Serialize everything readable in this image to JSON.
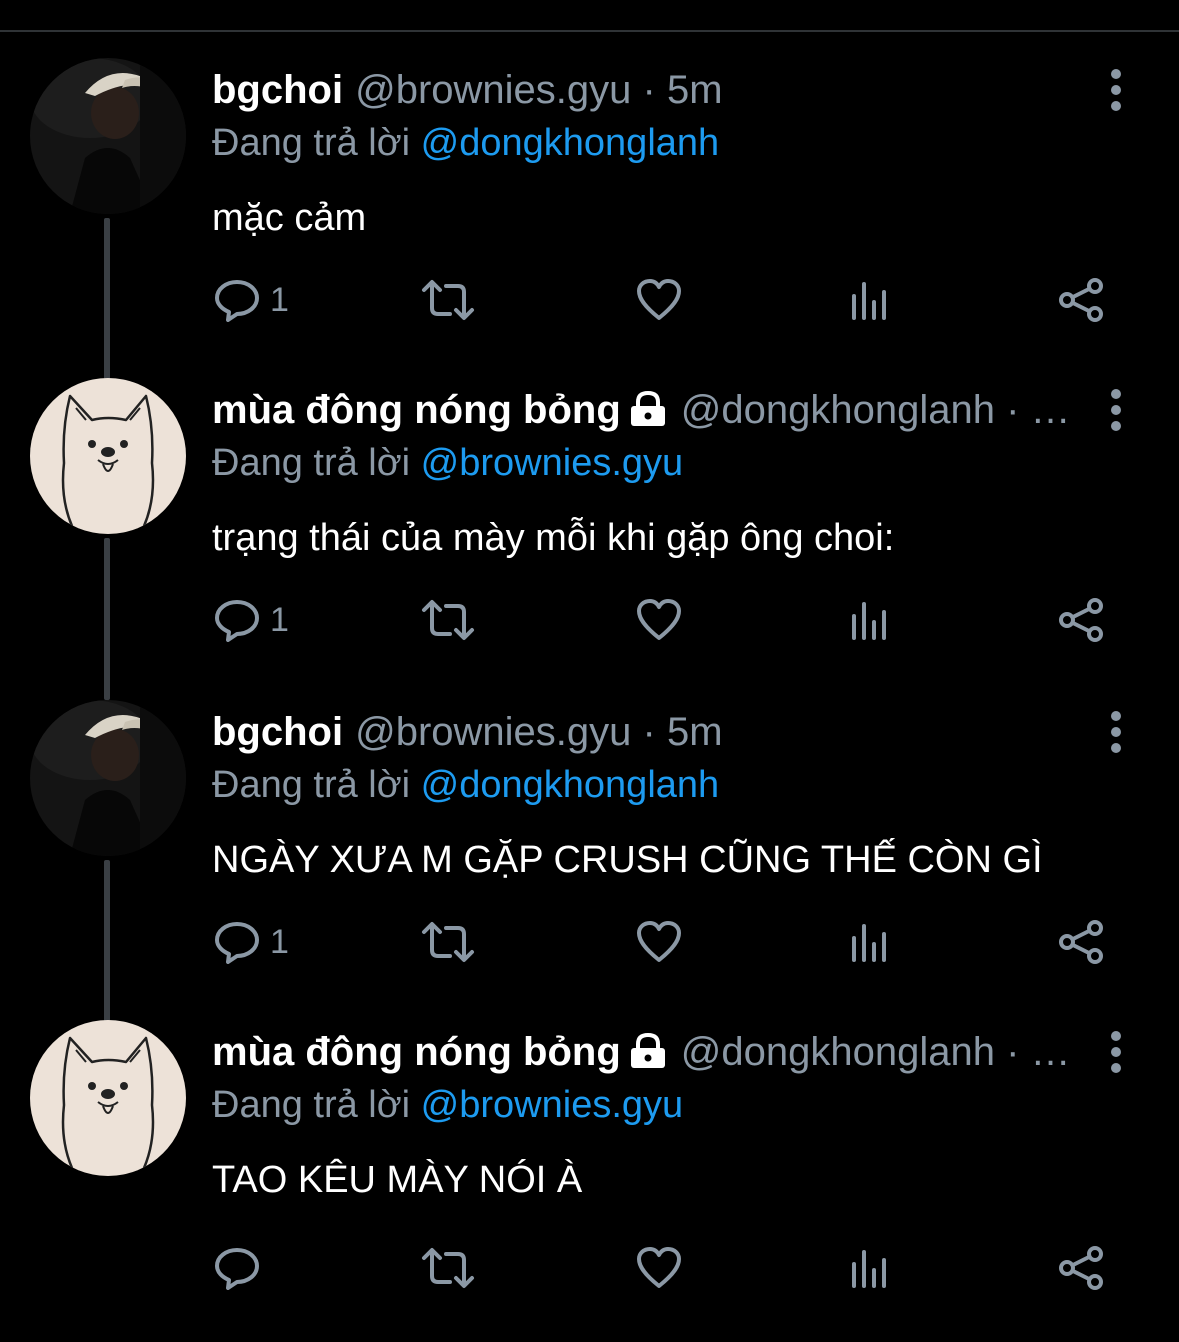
{
  "tweets": [
    {
      "name": "bgchoi",
      "locked": false,
      "handle": "@brownies.gyu",
      "separator": "·",
      "time": "5m",
      "reply_prefix": "Đang trả lời",
      "reply_to": "@dongkhonglanh",
      "text": "mặc cảm",
      "reply_count": "1",
      "avatar": "person-photo"
    },
    {
      "name": "mùa đông nóng bỏng",
      "locked": true,
      "handle": "@dongkhonglanh",
      "separator": "· …",
      "time": "",
      "reply_prefix": "Đang trả lời",
      "reply_to": "@brownies.gyu",
      "text": "trạng thái của mày mỗi khi gặp ông choi:",
      "reply_count": "1",
      "avatar": "dog-drawing"
    },
    {
      "name": "bgchoi",
      "locked": false,
      "handle": "@brownies.gyu",
      "separator": "·",
      "time": "5m",
      "reply_prefix": "Đang trả lời",
      "reply_to": "@dongkhonglanh",
      "text": "NGÀY XƯA M GẶP CRUSH CŨNG THẾ CÒN GÌ",
      "reply_count": "1",
      "avatar": "person-photo"
    },
    {
      "name": "mùa đông nóng bỏng",
      "locked": true,
      "handle": "@dongkhonglanh",
      "separator": "· …",
      "time": "",
      "reply_prefix": "Đang trả lời",
      "reply_to": "@brownies.gyu",
      "text": "TAO KÊU MÀY NÓI À",
      "reply_count": "",
      "avatar": "dog-drawing"
    }
  ],
  "icons": {
    "reply": "reply-icon",
    "retweet": "retweet-icon",
    "like": "heart-icon",
    "views": "analytics-icon",
    "share": "share-icon",
    "more": "more-vertical-icon",
    "lock": "lock-icon"
  },
  "colors": {
    "background": "#000000",
    "name": "#ffffff",
    "muted": "#8b98a5",
    "link": "#1d9bf0",
    "thread_line": "#3a3f44"
  }
}
